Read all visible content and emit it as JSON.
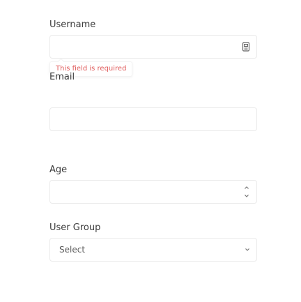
{
  "username": {
    "label": "Username",
    "value": "",
    "error": "This field is required"
  },
  "email": {
    "label": "Email",
    "value": ""
  },
  "age": {
    "label": "Age",
    "value": ""
  },
  "user_group": {
    "label": "User Group",
    "selected": "Select"
  },
  "icons": {
    "username_field": "id-card-icon",
    "age_up": "chevron-up-icon",
    "age_down": "chevron-down-icon",
    "group_dropdown": "chevron-down-icon"
  },
  "colors": {
    "error": "#e05b5b",
    "border": "#eaeaea"
  }
}
